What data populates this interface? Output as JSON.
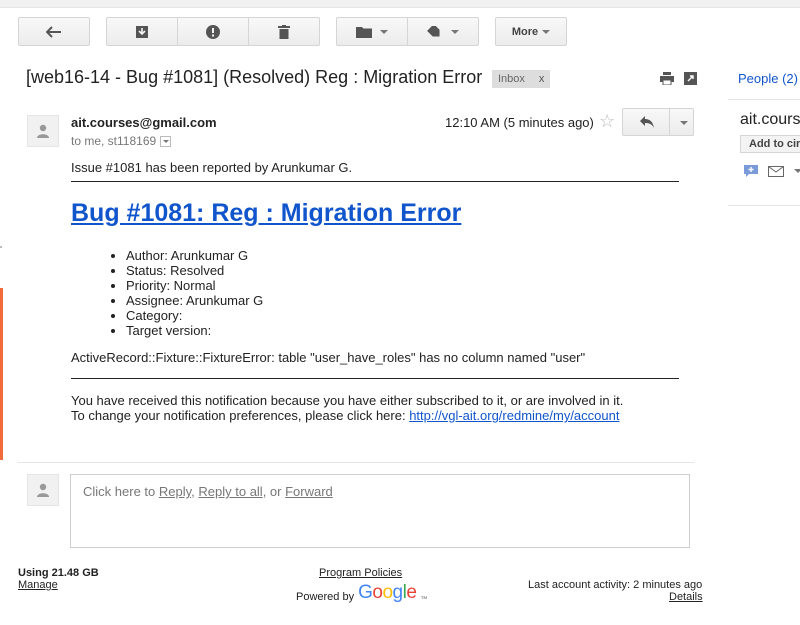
{
  "toolbar": {
    "more_label": "More"
  },
  "message": {
    "subject": "[web16-14 - Bug #1081] (Resolved) Reg : Migration Error",
    "label": "Inbox",
    "label_close": "x",
    "sender": "ait.courses@gmail.com",
    "recipients": "to me, st118169",
    "time": "12:10 AM (5 minutes ago)",
    "star_glyph": "☆"
  },
  "body": {
    "intro": "Issue #1081 has been reported by Arunkumar G.",
    "bug_title": "Bug #1081: Reg : Migration Error",
    "details": [
      "Author: Arunkumar G",
      "Status: Resolved",
      "Priority: Normal",
      "Assignee: Arunkumar G",
      "Category:",
      "Target version:"
    ],
    "error": "ActiveRecord::Fixture::FixtureError: table \"user_have_roles\" has no column named \"user\"",
    "notice_line1": "You have received this notification because you have either subscribed to it, or are involved in it.",
    "notice_line2_prefix": "To change your notification preferences, please click here: ",
    "notice_link": "http://vgl-ait.org/redmine/my/account"
  },
  "reply_box": {
    "prefix": "Click here to ",
    "reply": "Reply",
    "sep1": ", ",
    "reply_all": "Reply to all",
    "sep2": ", or ",
    "forward": "Forward"
  },
  "right_pane": {
    "people_label": "People (2)",
    "contact_name": "ait.courses",
    "add_to_circles": "Add to circles"
  },
  "footer": {
    "storage": "Using 21.48 GB",
    "manage": "Manage",
    "program_policies": "Program Policies",
    "powered_by": "Powered by",
    "google_letters": [
      "G",
      "o",
      "o",
      "g",
      "l",
      "e"
    ],
    "google_tm": "™",
    "last_activity": "Last account activity: 2 minutes ago",
    "details": "Details"
  },
  "colors": {
    "link_blue": "#1155cc",
    "left_accent": "#f26b3a"
  }
}
